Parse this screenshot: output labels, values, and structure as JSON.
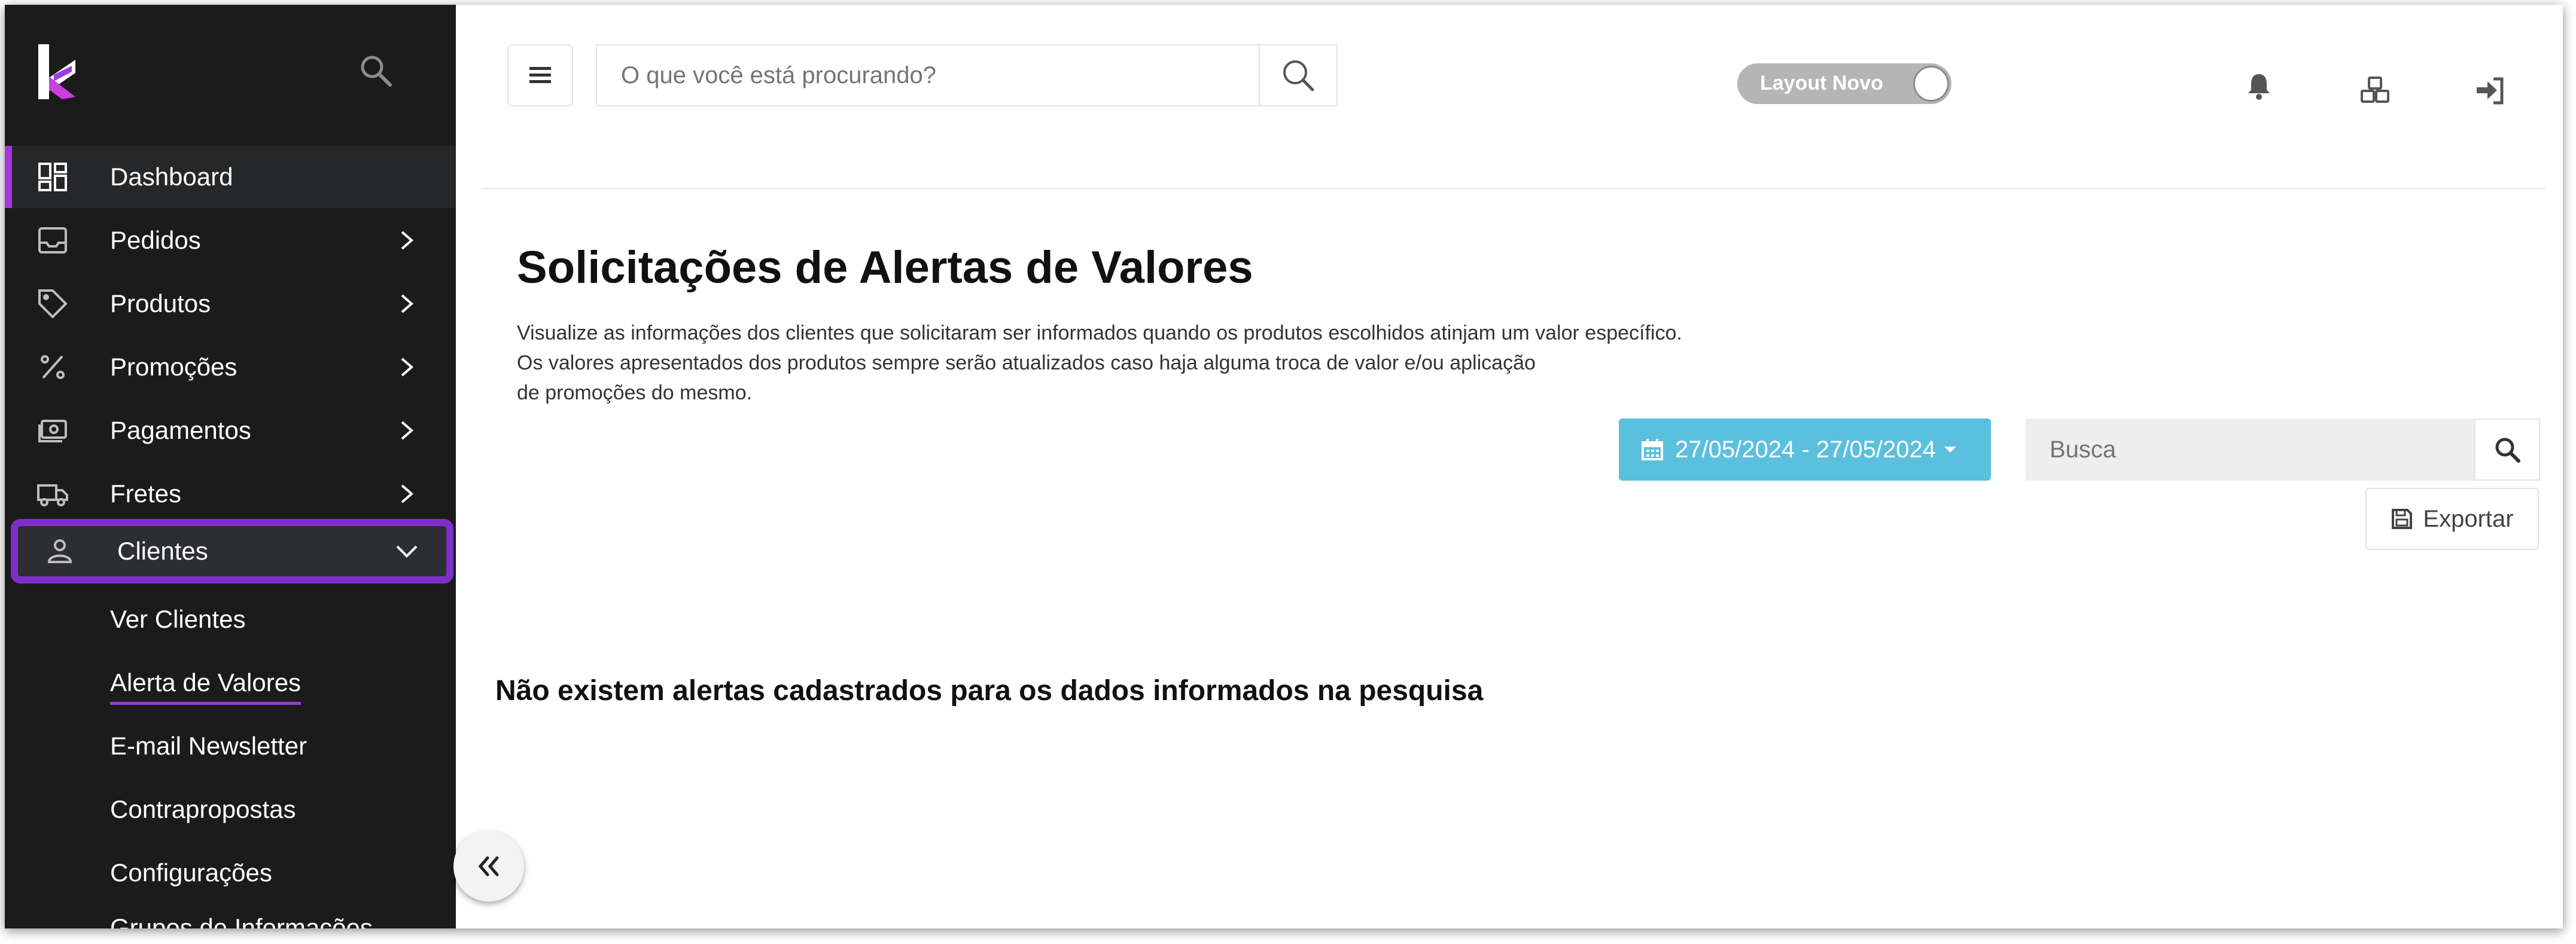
{
  "sidebar": {
    "logo_icon": "k-logo",
    "search_icon": "search-icon",
    "items": [
      {
        "label": "Dashboard",
        "icon": "dashboard-icon",
        "has_chevron": false
      },
      {
        "label": "Pedidos",
        "icon": "inbox-icon",
        "has_chevron": true
      },
      {
        "label": "Produtos",
        "icon": "tag-icon",
        "has_chevron": true
      },
      {
        "label": "Promoções",
        "icon": "percent-icon",
        "has_chevron": true
      },
      {
        "label": "Pagamentos",
        "icon": "cash-icon",
        "has_chevron": true
      },
      {
        "label": "Fretes",
        "icon": "truck-icon",
        "has_chevron": true
      },
      {
        "label": "Clientes",
        "icon": "user-icon",
        "has_chevron": true,
        "expanded": true
      }
    ],
    "subitems": [
      {
        "label": "Ver Clientes"
      },
      {
        "label": "Alerta de Valores",
        "current": true
      },
      {
        "label": "E-mail Newsletter"
      },
      {
        "label": "Contrapropostas"
      },
      {
        "label": "Configurações"
      },
      {
        "label": "Grupos de Informações"
      }
    ],
    "accent_color": "#a536e0",
    "highlight_border_color": "#7e2fc9"
  },
  "header": {
    "search_placeholder": "O que você está procurando?",
    "layout_toggle_label": "Layout Novo",
    "icons": [
      "bell-icon",
      "boxes-icon",
      "sign-in-icon"
    ]
  },
  "main": {
    "title": "Solicitações de Alertas de Valores",
    "description_lines": [
      "Visualize as informações dos clientes que solicitaram ser informados quando os produtos escolhidos atinjam um valor específico.",
      "Os valores apresentados dos produtos sempre serão atualizados caso haja alguma troca de valor e/ou aplicação",
      "de promoções do mesmo."
    ],
    "date_range": "27/05/2024 - 27/05/2024",
    "search_placeholder": "Busca",
    "export_label": "Exportar",
    "empty_message": "Não existem alertas cadastrados para os dados informados na pesquisa",
    "date_button_color": "#5bc0de"
  }
}
